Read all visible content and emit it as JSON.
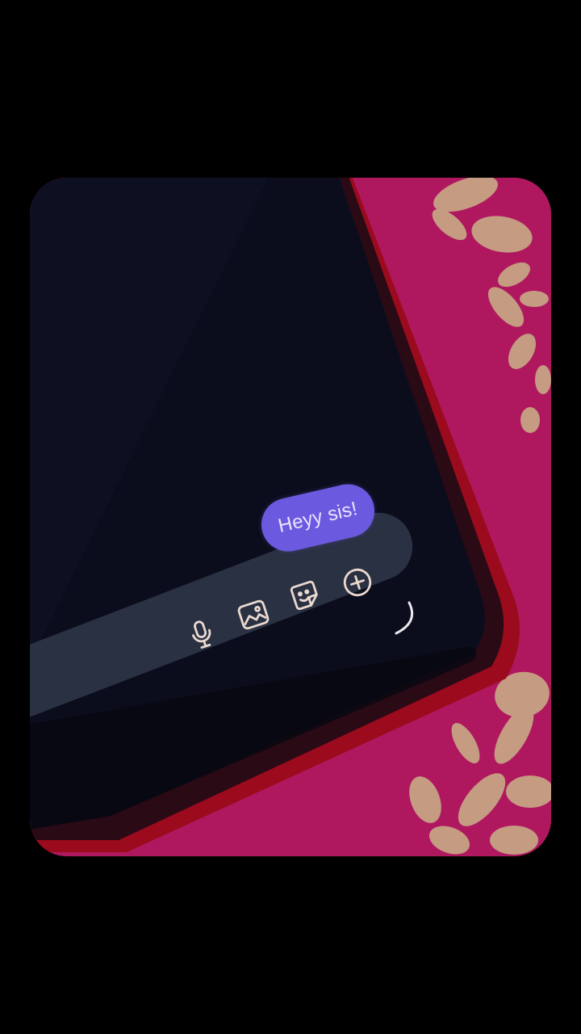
{
  "chat": {
    "message_text": "Heyy sis!"
  },
  "composer": {
    "icons": [
      "microphone-icon",
      "image-icon",
      "sticker-icon",
      "add-circle-icon"
    ]
  },
  "colors": {
    "background": "#000000",
    "screen": "#0b0d1c",
    "composer": "#2a3142",
    "bubble": "#6b5ae0",
    "phone_case": "#b3001e",
    "fabric": "#b0175d",
    "fabric_print": "#c9b48a"
  }
}
